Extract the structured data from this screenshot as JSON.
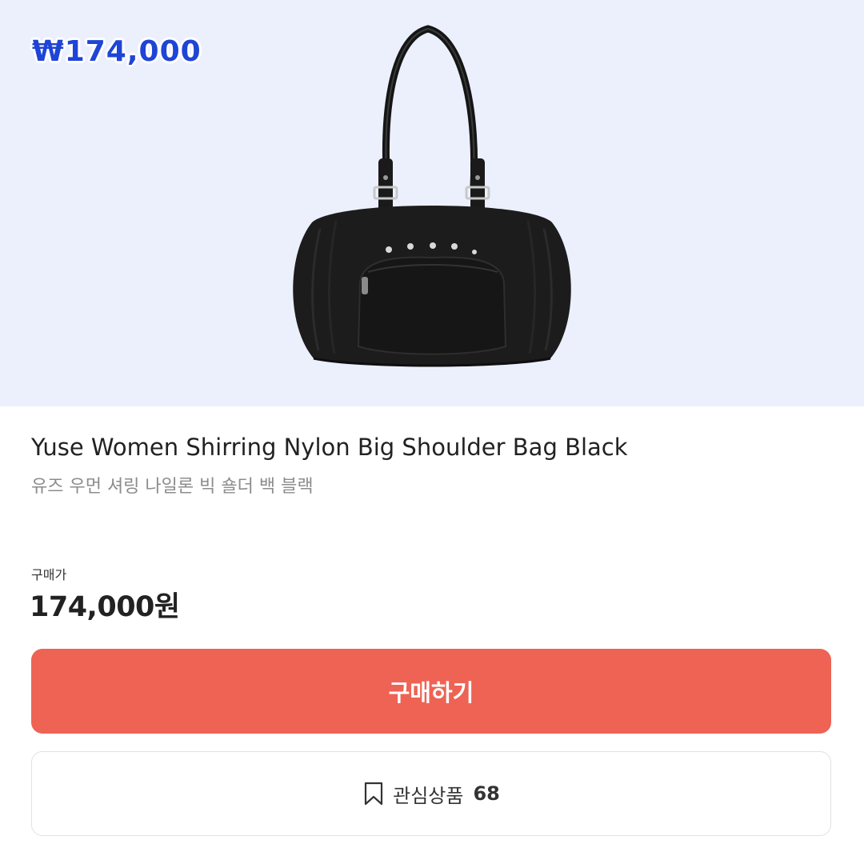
{
  "hero": {
    "price_overlay": "₩174,000",
    "image_alt": "black nylon shoulder bag"
  },
  "product": {
    "name_en": "Yuse Women Shirring Nylon Big Shoulder Bag Black",
    "name_ko": "유즈 우먼 셔링 나일론 빅 숄더 백 블랙"
  },
  "purchase": {
    "price_label": "구매가",
    "price_value": "174,000원"
  },
  "actions": {
    "buy_label": "구매하기",
    "wishlist_label": "관심상품",
    "wishlist_count": "68",
    "wishlist_icon": "bookmark-icon"
  },
  "colors": {
    "hero_bg": "#ecf0fd",
    "buy_button": "#ee6354",
    "overlay_price": "#1f45d6"
  }
}
